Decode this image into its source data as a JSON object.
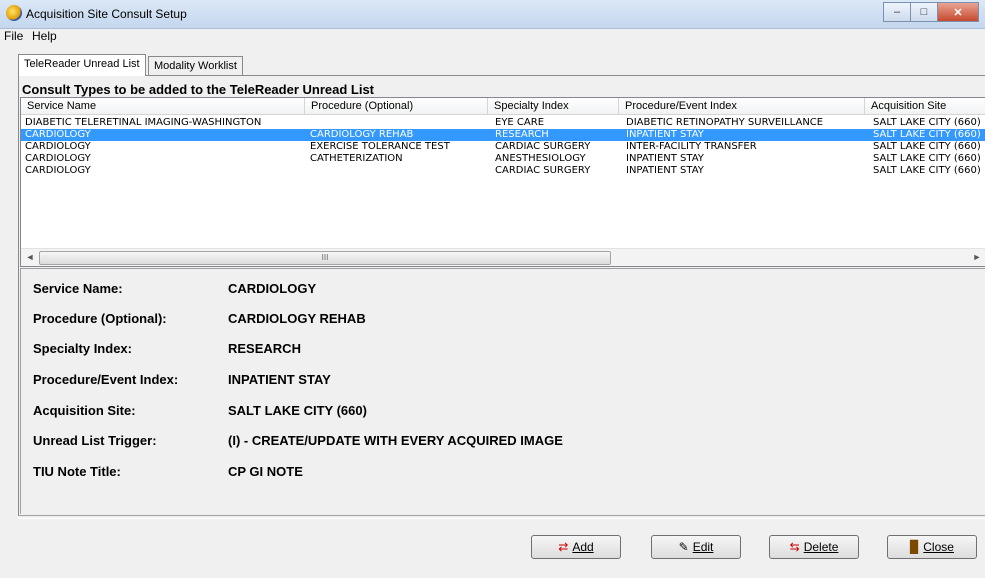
{
  "window": {
    "title": "Acquisition Site Consult Setup",
    "min": "–",
    "max": "□",
    "close": "✕"
  },
  "menu": {
    "file": "File",
    "help": "Help"
  },
  "tabs": [
    "TeleReader Unread List",
    "Modality Worklist"
  ],
  "list": {
    "heading": "Consult Types to be added to the TeleReader Unread List",
    "columns": [
      "Service Name",
      "Procedure (Optional)",
      "Specialty Index",
      "Procedure/Event Index",
      "Acquisition Site"
    ],
    "rows": [
      [
        "DIABETIC TELERETINAL IMAGING-WASHINGTON",
        "",
        "EYE CARE",
        "DIABETIC RETINOPATHY SURVEILLANCE",
        "SALT LAKE CITY (660)"
      ],
      [
        "CARDIOLOGY",
        "CARDIOLOGY REHAB",
        "RESEARCH",
        "INPATIENT STAY",
        "SALT LAKE CITY (660)"
      ],
      [
        "CARDIOLOGY",
        "EXERCISE TOLERANCE TEST",
        "CARDIAC SURGERY",
        "INTER-FACILITY TRANSFER",
        "SALT LAKE CITY (660)"
      ],
      [
        "CARDIOLOGY",
        "CATHETERIZATION",
        "ANESTHESIOLOGY",
        "INPATIENT STAY",
        "SALT LAKE CITY (660)"
      ],
      [
        "CARDIOLOGY",
        "",
        "CARDIAC SURGERY",
        "INPATIENT STAY",
        "SALT LAKE CITY (660)"
      ]
    ],
    "scroll_left": "◄",
    "scroll_right": "►",
    "scroll_grip": "III"
  },
  "detail": {
    "service_label": "Service Name:",
    "service_value": "CARDIOLOGY",
    "procedure_label": "Procedure (Optional):",
    "procedure_value": "CARDIOLOGY REHAB",
    "specialty_label": "Specialty Index:",
    "specialty_value": "RESEARCH",
    "event_label": "Procedure/Event Index:",
    "event_value": "INPATIENT STAY",
    "site_label": "Acquisition Site:",
    "site_value": "SALT LAKE CITY (660)",
    "trigger_label": "Unread List Trigger:",
    "trigger_value": "(I) - CREATE/UPDATE WITH EVERY ACQUIRED IMAGE",
    "tiu_label": "TIU Note Title:",
    "tiu_value": "CP GI NOTE"
  },
  "buttons": {
    "add": "Add",
    "edit": "Edit",
    "delete": "Delete",
    "close": "Close"
  },
  "icons": {
    "add": "add-icon",
    "edit": "edit-icon",
    "delete": "delete-icon",
    "close": "close-door-icon"
  }
}
